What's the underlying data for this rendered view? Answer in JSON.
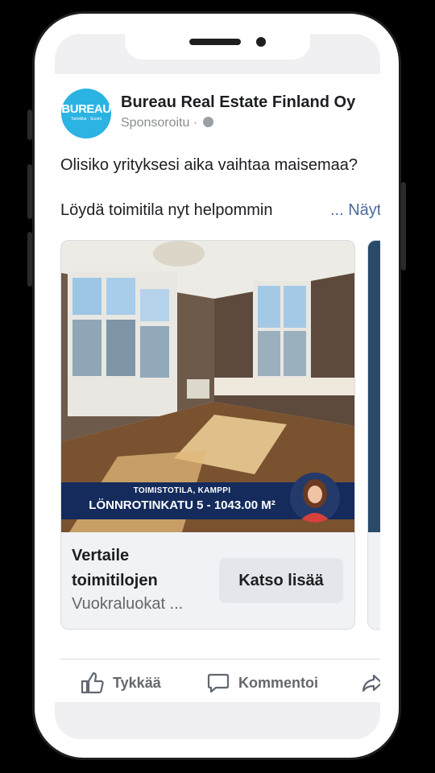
{
  "post": {
    "page_name": "Bureau Real Estate Finland Oy",
    "sponsored": "Sponsoroitu ·",
    "logo_text": "BUREAU",
    "logo_subtext": "Toimitilat · Suomi",
    "text_line1": "Olisiko yrityksesi aika vaihtaa maisemaa?",
    "text_line2": "Löydä toimitila nyt helpommin",
    "see_more": "... Näytä",
    "card": {
      "banner_subtitle": "TOIMISTOTILA, KAMPPI",
      "banner_title": "LÖNNROTINKATU 5 - 1043.00 M²",
      "title": "Vertaile toimitilojen",
      "description": "Vuokraluokat ...",
      "cta": "Katso lisää"
    },
    "actions": {
      "like": "Tykkää",
      "comment": "Kommentoi"
    }
  },
  "colors": {
    "brand": "#2bb3e3",
    "banner": "#142b5c",
    "link": "#4b6a9b"
  }
}
